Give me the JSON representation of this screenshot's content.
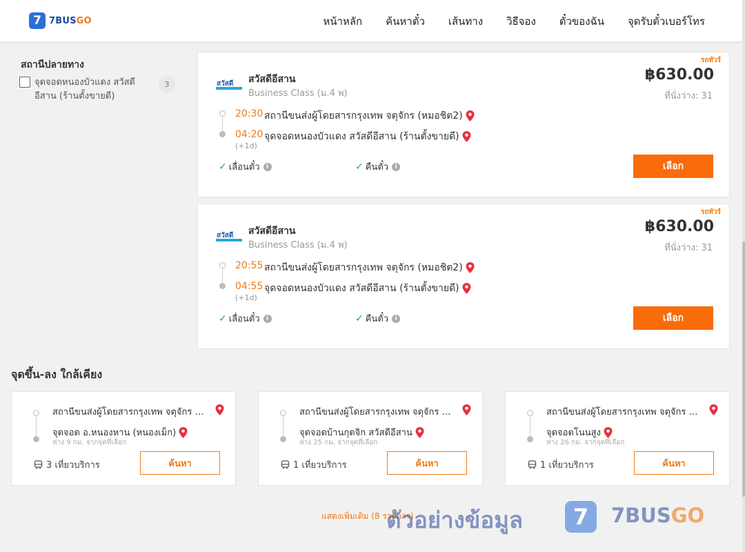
{
  "header": {
    "logo_mark": "7",
    "logo_prefix": "7BUS",
    "logo_suffix": "GO",
    "nav": [
      "หน้าหลัก",
      "ค้นหาตั๋ว",
      "เส้นทาง",
      "วิธีจอง",
      "ตั๋วของฉัน",
      "จุดรับตั๋วเบอร์โทร"
    ]
  },
  "filter": {
    "title": "สถานีปลายทาง",
    "option_label": "จุดจอดหนองบัวแดง สวัสดีอีสาน (ร้านตั้งขายดี)",
    "option_count": "3"
  },
  "trips": [
    {
      "bus_type": "รถทัวร์",
      "operator": "สวัสดีอีสาน",
      "class": "Business Class (ม.4 พ)",
      "price": "฿630.00",
      "seats": "ที่นั่งว่าง: 31",
      "depart_time": "20:30",
      "depart_stop": "สถานีขนส่งผู้โดยสารกรุงเทพ จตุจักร (หมอชิต2)",
      "arrive_time": "04:20",
      "arrive_stop": "จุดจอดหนองบัวแดง สวัสดีอีสาน (ร้านตั้งขายดี)",
      "next_day": "(+1d)",
      "policy_change": "เลื่อนตั๋ว",
      "policy_refund": "คืนตั๋ว",
      "select_label": "เลือก"
    },
    {
      "bus_type": "รถทัวร์",
      "operator": "สวัสดีอีสาน",
      "class": "Business Class (ม.4 พ)",
      "price": "฿630.00",
      "seats": "ที่นั่งว่าง: 31",
      "depart_time": "20:55",
      "depart_stop": "สถานีขนส่งผู้โดยสารกรุงเทพ จตุจักร (หมอชิต2)",
      "arrive_time": "04:55",
      "arrive_stop": "จุดจอดหนองบัวแดง สวัสดีอีสาน (ร้านตั้งขายดี)",
      "next_day": "(+1d)",
      "policy_change": "เลื่อนตั๋ว",
      "policy_refund": "คืนตั๋ว",
      "select_label": "เลือก"
    }
  ],
  "nearby": {
    "title": "จุดขึ้น-ลง ใกล้เคียง",
    "cards": [
      {
        "from": "สถานีขนส่งผู้โดยสารกรุงเทพ จตุจักร (...",
        "to": "จุดจอด อ.หนองหาน (หนองเม็ก)",
        "distance": "ห่าง 9 กม. จากจุดที่เลือก",
        "trips": "3 เที่ยวบริการ",
        "button": "ค้นหา"
      },
      {
        "from": "สถานีขนส่งผู้โดยสารกรุงเทพ จตุจักร (...",
        "to": "จุดจอดบ้านกุดจิก สวัสดีอีสาน",
        "distance": "ห่าง 25 กม. จากจุดที่เลือก",
        "trips": "1 เที่ยวบริการ",
        "button": "ค้นหา"
      },
      {
        "from": "สถานีขนส่งผู้โดยสารกรุงเทพ จตุจักร (...",
        "to": "จุดจอดโนนสูง",
        "distance": "ห่าง 26 กม. จากจุดที่เลือก",
        "trips": "1 เที่ยวบริการ",
        "button": "ค้นหา"
      }
    ],
    "show_more": "แสดงเพิ่มเติม (8 รายการ)"
  },
  "watermark": {
    "text": "ตัวอย่างข้อมูล",
    "logo_mark": "7",
    "brand_prefix": "7BUS",
    "brand_suffix": "GO"
  },
  "colors": {
    "accent": "#f07a14",
    "button": "#f86c0b",
    "brand_blue": "#2c6fd7",
    "check_green": "#2fa44f"
  }
}
